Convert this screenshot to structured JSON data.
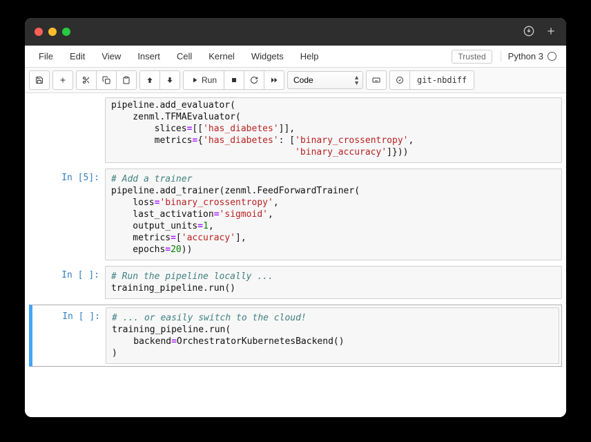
{
  "menu": {
    "file": "File",
    "edit": "Edit",
    "view": "View",
    "insert": "Insert",
    "cell": "Cell",
    "kernel": "Kernel",
    "widgets": "Widgets",
    "help": "Help"
  },
  "trusted": "Trusted",
  "kernel_name": "Python 3",
  "toolbar": {
    "run_label": "Run",
    "celltype": "Code",
    "nbdiff": "git-nbdiff"
  },
  "cells": [
    {
      "prompt": "",
      "lines": [
        {
          "segments": [
            {
              "t": "pipeline.add_evaluator("
            }
          ]
        },
        {
          "segments": [
            {
              "t": "    zenml.TFMAEvaluator("
            }
          ]
        },
        {
          "segments": [
            {
              "t": "        slices"
            },
            {
              "t": "=",
              "cls": "o"
            },
            {
              "t": "[["
            },
            {
              "t": "'has_diabetes'",
              "cls": "s"
            },
            {
              "t": "]],"
            }
          ]
        },
        {
          "segments": [
            {
              "t": "        metrics"
            },
            {
              "t": "=",
              "cls": "o"
            },
            {
              "t": "{"
            },
            {
              "t": "'has_diabetes'",
              "cls": "s"
            },
            {
              "t": ": ["
            },
            {
              "t": "'binary_crossentropy'",
              "cls": "s"
            },
            {
              "t": ","
            }
          ]
        },
        {
          "segments": [
            {
              "t": "                                  "
            },
            {
              "t": "'binary_accuracy'",
              "cls": "s"
            },
            {
              "t": "]}))"
            }
          ]
        }
      ]
    },
    {
      "prompt": "In [5]:",
      "lines": [
        {
          "segments": [
            {
              "t": "# Add a trainer",
              "cls": "c"
            }
          ]
        },
        {
          "segments": [
            {
              "t": "pipeline.add_trainer(zenml.FeedForwardTrainer("
            }
          ]
        },
        {
          "segments": [
            {
              "t": "    loss"
            },
            {
              "t": "=",
              "cls": "o"
            },
            {
              "t": "'binary_crossentropy'",
              "cls": "s"
            },
            {
              "t": ","
            }
          ]
        },
        {
          "segments": [
            {
              "t": "    last_activation"
            },
            {
              "t": "=",
              "cls": "o"
            },
            {
              "t": "'sigmoid'",
              "cls": "s"
            },
            {
              "t": ","
            }
          ]
        },
        {
          "segments": [
            {
              "t": "    output_units"
            },
            {
              "t": "=",
              "cls": "o"
            },
            {
              "t": "1",
              "cls": "m"
            },
            {
              "t": ","
            }
          ]
        },
        {
          "segments": [
            {
              "t": "    metrics"
            },
            {
              "t": "=",
              "cls": "o"
            },
            {
              "t": "["
            },
            {
              "t": "'accuracy'",
              "cls": "s"
            },
            {
              "t": "],"
            }
          ]
        },
        {
          "segments": [
            {
              "t": "    epochs"
            },
            {
              "t": "=",
              "cls": "o"
            },
            {
              "t": "20",
              "cls": "m"
            },
            {
              "t": "))"
            }
          ]
        }
      ]
    },
    {
      "prompt": "In [ ]:",
      "lines": [
        {
          "segments": [
            {
              "t": "# Run the pipeline locally ...",
              "cls": "c"
            }
          ]
        },
        {
          "segments": [
            {
              "t": "training_pipeline.run()"
            }
          ]
        }
      ]
    },
    {
      "prompt": "In [ ]:",
      "selected": true,
      "lines": [
        {
          "segments": [
            {
              "t": "# ... or easily switch to the cloud!",
              "cls": "c"
            }
          ]
        },
        {
          "segments": [
            {
              "t": "training_pipeline.run("
            }
          ]
        },
        {
          "segments": [
            {
              "t": "    backend"
            },
            {
              "t": "=",
              "cls": "o"
            },
            {
              "t": "OrchestratorKubernetesBackend()"
            }
          ]
        },
        {
          "segments": [
            {
              "t": ")"
            }
          ]
        }
      ]
    }
  ]
}
